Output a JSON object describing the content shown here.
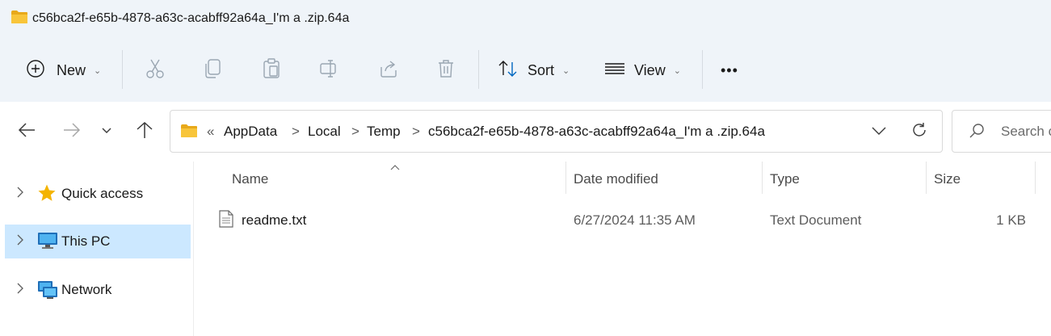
{
  "window": {
    "title": "c56bca2f-e65b-4878-a63c-acabff92a64a_I'm a .zip.64a"
  },
  "toolbar": {
    "new_label": "New",
    "sort_label": "Sort",
    "view_label": "View",
    "more_label": "•••"
  },
  "address": {
    "overflow": "«",
    "crumbs": [
      "AppData",
      "Local",
      "Temp",
      "c56bca2f-e65b-4878-a63c-acabff92a64a_I'm a .zip.64a"
    ],
    "separator": ">"
  },
  "search": {
    "placeholder": "Search c"
  },
  "sidebar": {
    "items": [
      {
        "label": "Quick access",
        "selected": false
      },
      {
        "label": "This PC",
        "selected": true
      },
      {
        "label": "Network",
        "selected": false
      }
    ]
  },
  "table": {
    "columns": [
      "Name",
      "Date modified",
      "Type",
      "Size"
    ],
    "rows": [
      {
        "name": "readme.txt",
        "date": "6/27/2024 11:35 AM",
        "type": "Text Document",
        "size": "1 KB"
      }
    ]
  },
  "colors": {
    "chrome_bg": "#eff4f9",
    "selected_bg": "#cce8ff",
    "folder": "#f8c53a",
    "accent": "#0067c0"
  }
}
